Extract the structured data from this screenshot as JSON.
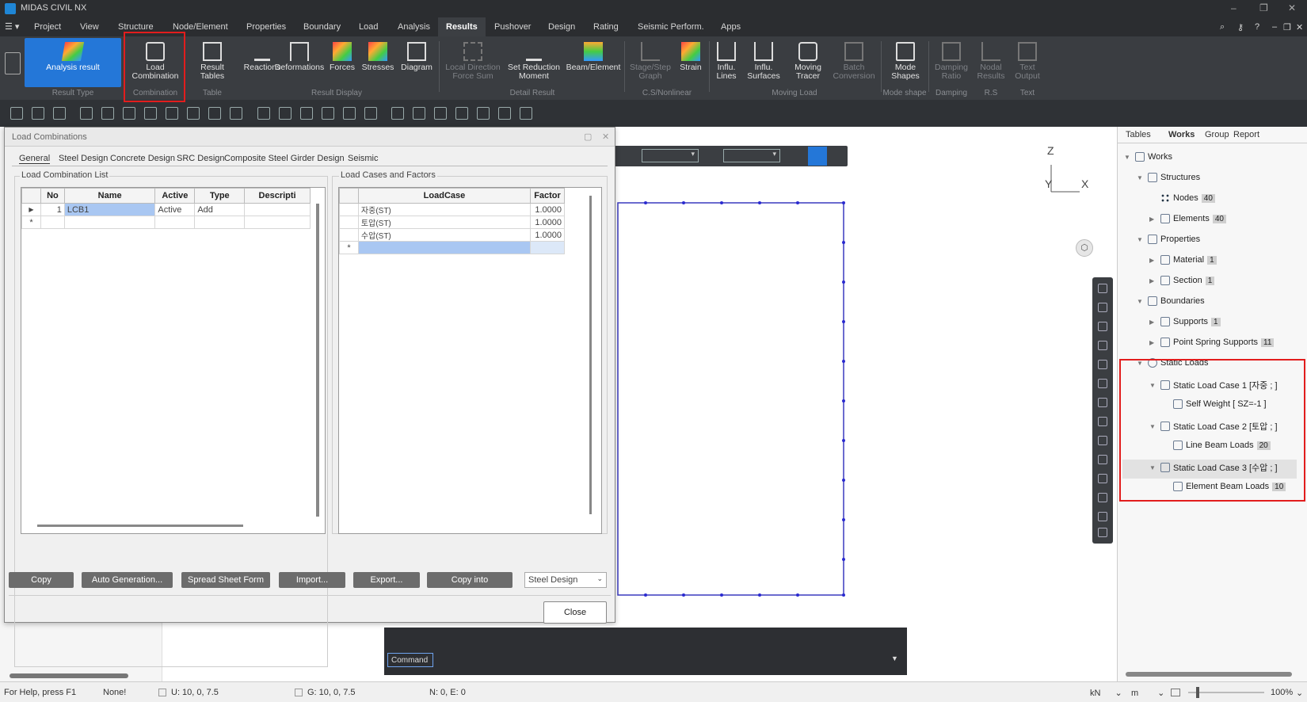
{
  "titlebar": {
    "title": "MIDAS CIVIL NX"
  },
  "menu": [
    "Project",
    "View",
    "Structure",
    "Node/Element",
    "Properties",
    "Boundary",
    "Load",
    "Analysis",
    "Results",
    "Pushover",
    "Design",
    "Rating",
    "Seismic Perform.",
    "Apps"
  ],
  "ribbon": {
    "analysis_result": "Analysis result",
    "load_combination": [
      "Load",
      "Combination"
    ],
    "result_tables": [
      "Result",
      "Tables"
    ],
    "reactions": "Reactions",
    "deformations": "Deformations",
    "forces": "Forces",
    "stresses": "Stresses",
    "diagram": "Diagram",
    "local_direction": [
      "Local Direction",
      "Force Sum"
    ],
    "set_reduction": [
      "Set Reduction",
      "Moment"
    ],
    "beam_element": "Beam/Element",
    "stage_step": [
      "Stage/Step",
      "Graph"
    ],
    "strain": "Strain",
    "influ_lines": [
      "Influ.",
      "Lines"
    ],
    "influ_surfaces": [
      "Influ.",
      "Surfaces"
    ],
    "moving_tracer": [
      "Moving",
      "Tracer"
    ],
    "batch_conversion": [
      "Batch",
      "Conversion"
    ],
    "mode_shapes": [
      "Mode",
      "Shapes"
    ],
    "damping_ratio": [
      "Damping",
      "Ratio"
    ],
    "nodal_results": [
      "Nodal",
      "Results"
    ],
    "text_output": [
      "Text",
      "Output"
    ],
    "groups": [
      "Result Type",
      "Combination",
      "Table",
      "Result Display",
      "Detail Result",
      "C.S/Nonlinear",
      "Moving Load",
      "Mode shape",
      "Damping",
      "R.S",
      "Text"
    ]
  },
  "dialog": {
    "title": "Load Combinations",
    "tabs": [
      "General",
      "Steel Design",
      "Concrete Design",
      "SRC Design",
      "Composite Steel Girder Design",
      "Seismic"
    ],
    "list_label": "Load Combination List",
    "factors_label": "Load Cases and Factors",
    "list_headers": [
      "No",
      "Name",
      "Active",
      "Type",
      "Descripti"
    ],
    "list_rows": [
      {
        "no": "1",
        "name": "LCB1",
        "active": "Active",
        "type": "Add",
        "desc": ""
      }
    ],
    "factor_headers": [
      "LoadCase",
      "Factor"
    ],
    "factor_rows": [
      {
        "case": "자중(ST)",
        "factor": "1.0000"
      },
      {
        "case": "토압(ST)",
        "factor": "1.0000"
      },
      {
        "case": "수압(ST)",
        "factor": "1.0000"
      }
    ],
    "buttons": [
      "Copy",
      "Auto Generation...",
      "Spread Sheet Form",
      "Import...",
      "Export...",
      "Copy into"
    ],
    "design_select": "Steel Design",
    "close": "Close"
  },
  "panel": {
    "tabs": [
      "Tables",
      "Works",
      "Group",
      "Report"
    ],
    "tree": [
      {
        "label": "Works",
        "level": 0
      },
      {
        "label": "Structures",
        "level": 1
      },
      {
        "label": "Nodes",
        "badge": "40",
        "level": 2
      },
      {
        "label": "Elements",
        "badge": "40",
        "level": 2
      },
      {
        "label": "Properties",
        "level": 1
      },
      {
        "label": "Material",
        "badge": "1",
        "level": 2
      },
      {
        "label": "Section",
        "badge": "1",
        "level": 2
      },
      {
        "label": "Boundaries",
        "level": 1
      },
      {
        "label": "Supports",
        "badge": "1",
        "level": 2
      },
      {
        "label": "Point Spring Supports",
        "badge": "11",
        "level": 2
      },
      {
        "label": "Static Loads",
        "level": 1
      },
      {
        "label": "Static Load Case 1 [자중 ; ]",
        "level": 2
      },
      {
        "label": "Self Weight [ SZ=-1 ]",
        "level": 3
      },
      {
        "label": "Static Load Case 2 [토압 ; ]",
        "level": 2
      },
      {
        "label": "Line Beam Loads",
        "badge": "20",
        "level": 3
      },
      {
        "label": "Static Load Case 3 [수압 ; ]",
        "level": 2
      },
      {
        "label": "Element Beam Loads",
        "badge": "10",
        "level": 3
      }
    ]
  },
  "axes": {
    "z": "Z",
    "y": "Y",
    "x": "X"
  },
  "command": {
    "label": "Command"
  },
  "status": {
    "help": "For Help, press F1",
    "none": "None!",
    "u": "U: 10, 0, 7.5",
    "g": "G: 10, 0, 7.5",
    "ne": "N: 0, E: 0",
    "force_unit": "kN",
    "length_unit": "m",
    "zoom": "100%"
  }
}
